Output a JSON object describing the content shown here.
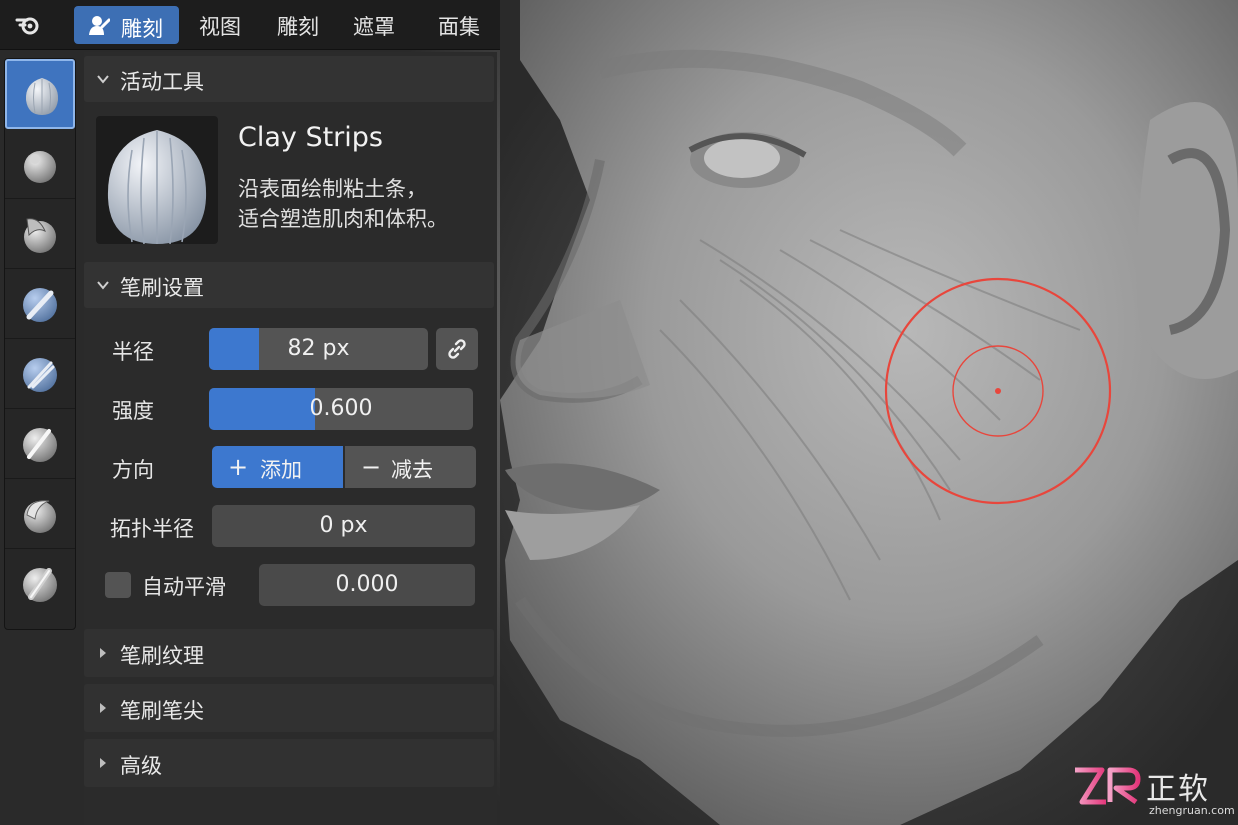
{
  "header": {
    "mode_label": "雕刻",
    "menus": [
      "视图",
      "雕刻",
      "遮罩",
      "面集"
    ]
  },
  "toolbar": {
    "tools": [
      {
        "icon": "clay-strips-brush-icon",
        "active": true
      },
      {
        "icon": "draw-brush-icon",
        "active": false
      },
      {
        "icon": "crease-brush-icon",
        "active": false
      },
      {
        "icon": "smooth-brush-icon",
        "active": false
      },
      {
        "icon": "flatten-brush-icon",
        "active": false
      },
      {
        "icon": "scrape-brush-icon",
        "active": false
      },
      {
        "icon": "grab-brush-icon",
        "active": false
      },
      {
        "icon": "pinch-brush-icon",
        "active": false
      }
    ]
  },
  "active_tool": {
    "section_title": "活动工具",
    "name": "Clay Strips",
    "description_line1": "沿表面绘制粘土条，",
    "description_line2": "适合塑造肌肉和体积。"
  },
  "brush_settings": {
    "section_title": "笔刷设置",
    "radius": {
      "label": "半径",
      "value": "82 px",
      "fill_fraction": 0.23
    },
    "strength": {
      "label": "强度",
      "value": "0.600",
      "fill_fraction": 0.4
    },
    "direction": {
      "label": "方向",
      "add_symbol": "+",
      "add_label": "添加",
      "subtract_symbol": "−",
      "subtract_label": "减去",
      "selected": "add"
    },
    "topology_radius": {
      "label": "拓扑半径",
      "value": "0 px"
    },
    "auto_smooth": {
      "label": "自动平滑",
      "value": "0.000",
      "checked": false
    }
  },
  "collapsed_sections": [
    "笔刷纹理",
    "笔刷笔尖",
    "高级"
  ],
  "watermark": {
    "text": "正软",
    "subtext": "zhengruan.com"
  },
  "colors": {
    "accent": "#3d78cf",
    "cursor": "#e8463c",
    "panel": "#2b2b2b"
  }
}
